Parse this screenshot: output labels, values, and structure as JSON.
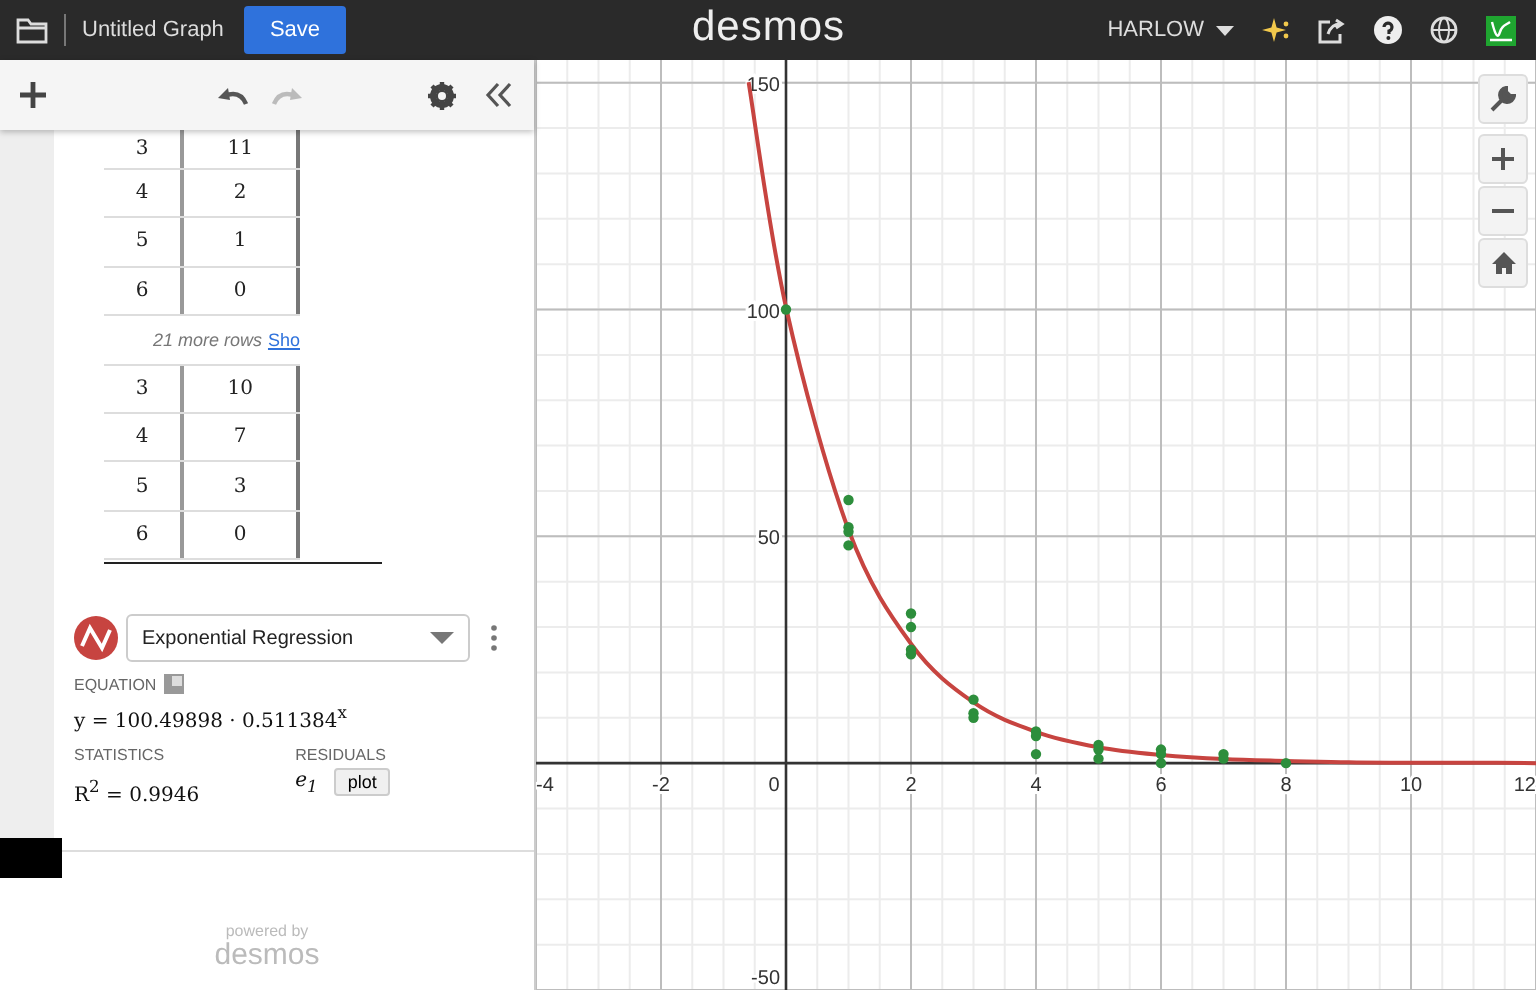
{
  "header": {
    "title": "Untitled Graph",
    "save_button": "Save",
    "logo": "desmos",
    "user": "HARLOW"
  },
  "tables": [
    {
      "rows": [
        [
          "3",
          "11"
        ],
        [
          "4",
          "2"
        ],
        [
          "5",
          "1"
        ],
        [
          "6",
          "0"
        ]
      ]
    },
    {
      "rows": [
        [
          "3",
          "10"
        ],
        [
          "4",
          "7"
        ],
        [
          "5",
          "3"
        ],
        [
          "6",
          "0"
        ]
      ]
    }
  ],
  "more_rows": {
    "text": "21 more rows",
    "link": "Sho"
  },
  "regression": {
    "model": "Exponential Regression",
    "equation_label": "EQUATION",
    "equation": "y = 100.49898 · 0.511384$^{x}$",
    "statistics_label": "STATISTICS",
    "r_squared": "R$^{2}$ = 0.9946",
    "residuals_label": "RESIDUALS",
    "residual_variable": "e$_{1}$",
    "plot_button": "plot"
  },
  "footer": {
    "powered_by": "powered by",
    "logo": "desmos"
  },
  "graph": {
    "chart_data": {
      "type": "scatter",
      "xlim": [
        -4,
        12
      ],
      "ylim": [
        -50,
        155
      ],
      "xticks": [
        -4,
        -2,
        0,
        2,
        4,
        6,
        8,
        10,
        12
      ],
      "yticks": [
        -50,
        50,
        100,
        150
      ],
      "grid": true,
      "x": [
        -0.6,
        0,
        1,
        1,
        1,
        1,
        2,
        2,
        2,
        2,
        3,
        3,
        3,
        4,
        4,
        4,
        5,
        5,
        5,
        6,
        6,
        6,
        7,
        7,
        8,
        9,
        10,
        11,
        12
      ],
      "series": [
        {
          "color": "#2d8e3c",
          "values": [
            null,
            100,
            58,
            52,
            51,
            48,
            33,
            30,
            25,
            24,
            14,
            11,
            10,
            7,
            6,
            2,
            4,
            3,
            1,
            3,
            2,
            0,
            2,
            1,
            0,
            null,
            null,
            null,
            null
          ]
        },
        {
          "type": "line",
          "color": "#c74440",
          "values": [
            150.1,
            100.5,
            51.4,
            51.4,
            51.4,
            51.4,
            26.3,
            26.3,
            26.3,
            26.3,
            13.4,
            13.4,
            13.4,
            6.9,
            6.9,
            6.9,
            3.5,
            3.5,
            3.5,
            1.8,
            1.8,
            1.8,
            0.9,
            0.9,
            0.5,
            0.2,
            0.1,
            0.1,
            0
          ]
        }
      ]
    }
  }
}
